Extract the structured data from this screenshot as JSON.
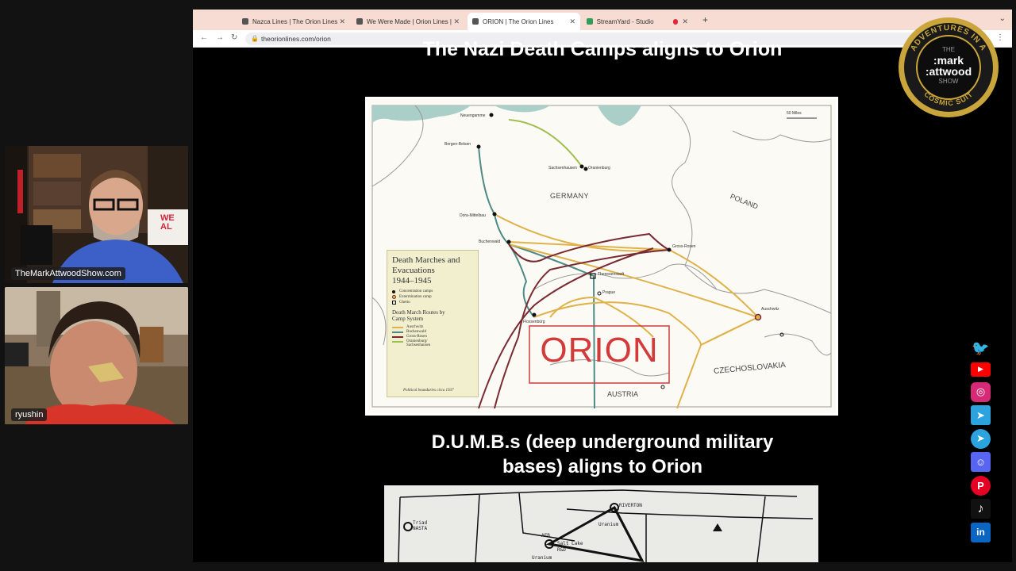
{
  "participants": [
    {
      "name": "TheMarkAttwoodShow.com",
      "sign_text": "WE AL"
    },
    {
      "name": "ryushin"
    }
  ],
  "browser": {
    "tabs": [
      {
        "label": "Nazca Lines | The Orion Lines",
        "active": false
      },
      {
        "label": "We Were Made | Orion Lines | ",
        "active": false
      },
      {
        "label": "ORION | The Orion Lines",
        "active": true
      },
      {
        "label": "StreamYard - Studio",
        "active": false
      }
    ],
    "url": "theorionlines.com/orion"
  },
  "page": {
    "heading1": "The Nazi Death Camps aligns to Orion",
    "heading2_line1": "D.U.M.B.s (deep underground military",
    "heading2_line2": "bases) aligns to Orion"
  },
  "map1": {
    "orion_label": "ORION",
    "scale": "50 Miles",
    "countries": [
      "GERMANY",
      "POLAND",
      "CZECHOSLOVAKIA",
      "AUSTRIA"
    ],
    "cities": [
      "Neuengamme",
      "Bergen-Belsen",
      "Sachsenhausen",
      "Oranienburg",
      "Dora-Mittelbau",
      "Buchenwald",
      "Gross-Rosen",
      "Theresienstadt",
      "Prague",
      "Flossenbürg",
      "Auschwitz"
    ],
    "legend": {
      "title": "Death Marches and Evacuations",
      "years": "1944–1945",
      "symbols": [
        "Concentration camps",
        "Extermination camp",
        "Ghetto"
      ],
      "routes_title": "Death March Routes by Camp System",
      "routes": [
        {
          "name": "Auschwitz",
          "color": "#e0b24a"
        },
        {
          "name": "Buchenwald",
          "color": "#4e8a88"
        },
        {
          "name": "Gross-Rosen",
          "color": "#7a2a32"
        },
        {
          "name": "Oranienburg/ Sachsenhausen",
          "color": "#9fbf52"
        }
      ],
      "footer": "Political boundaries circa 1937"
    }
  },
  "map2": {
    "labels": [
      "Triad NASTA",
      "RIVERTON",
      "Uranium",
      "AFB",
      "Salt Lake",
      "R&D",
      "Uranium"
    ]
  },
  "logo": {
    "arc_top": "ADVENTURES IN A",
    "arc_bottom": "COSMIC SUIT",
    "line1": "THE",
    "line2": ":mark",
    "line3": ":attwood",
    "line4": "SHOW"
  },
  "social": [
    {
      "name": "twitter-icon",
      "color": "#1da1f2",
      "glyph": "🐦"
    },
    {
      "name": "youtube-icon",
      "color": "#ff0000",
      "glyph": "▶"
    },
    {
      "name": "instagram-icon",
      "color": "#d62976",
      "glyph": "◎"
    },
    {
      "name": "telegram-icon",
      "color": "#2aa3df",
      "glyph": "➤"
    },
    {
      "name": "telegram-alt-icon",
      "color": "#2aa3df",
      "glyph": "➤"
    },
    {
      "name": "discord-icon",
      "color": "#5865f2",
      "glyph": "☺"
    },
    {
      "name": "pinterest-icon",
      "color": "#e60023",
      "glyph": "P"
    },
    {
      "name": "tiktok-icon",
      "color": "#111111",
      "glyph": "♪"
    },
    {
      "name": "linkedin-icon",
      "color": "#0a66c2",
      "glyph": "in"
    }
  ]
}
